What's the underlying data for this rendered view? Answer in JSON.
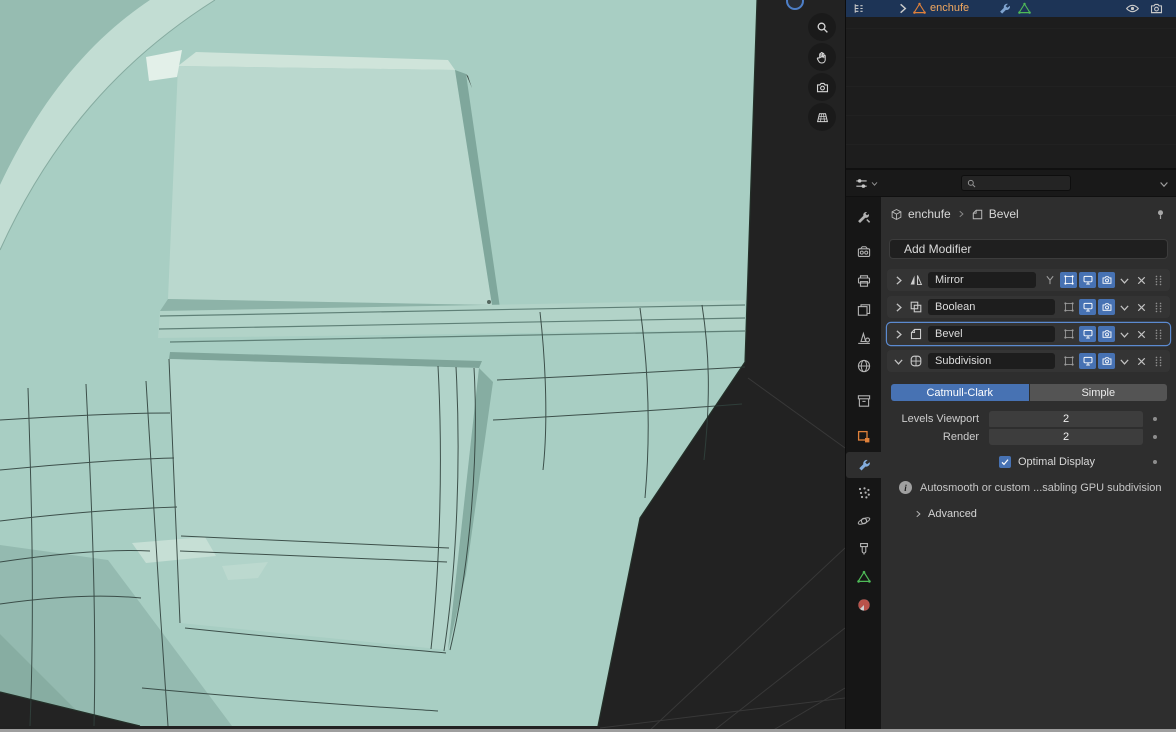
{
  "colors": {
    "accent": "#4772b3",
    "mesh": "#a8cec3",
    "selected_row": "#1d3456",
    "object_icon": "#e0813a",
    "mesh_data_icon": "#4fba58"
  },
  "viewport": {
    "nav_icons": [
      "zoom",
      "pan",
      "camera-view",
      "perspective-grid"
    ],
    "gizmo": "axis-ball-partial"
  },
  "outliner": {
    "object": {
      "name": "enchufe"
    }
  },
  "properties": {
    "search_placeholder": "",
    "breadcrumb": {
      "object": "enchufe",
      "modifier": "Bevel"
    },
    "add_modifier_label": "Add Modifier",
    "modifiers": [
      {
        "name": "Mirror",
        "type": "Mirror",
        "active": false,
        "expanded": false
      },
      {
        "name": "Boolean",
        "type": "Boolean",
        "active": false,
        "expanded": false
      },
      {
        "name": "Bevel",
        "type": "Bevel",
        "active": true,
        "expanded": false
      },
      {
        "name": "Subdivision",
        "type": "Subdivision",
        "active": false,
        "expanded": true
      }
    ],
    "subdivision": {
      "options": [
        "Catmull-Clark",
        "Simple"
      ],
      "selected_option": "Catmull-Clark",
      "levels_viewport_label": "Levels Viewport",
      "levels_viewport_value": "2",
      "render_label": "Render",
      "render_value": "2",
      "optimal_display_label": "Optimal Display",
      "optimal_display_checked": true,
      "info_message": "Autosmooth or custom ...sabling GPU subdivision",
      "advanced_label": "Advanced"
    },
    "tabs": [
      "tool",
      "render",
      "output",
      "view-layer",
      "scene",
      "world",
      "collection",
      "object",
      "modifiers",
      "particles",
      "physics",
      "constraints",
      "object-data",
      "material"
    ],
    "active_tab": "modifiers"
  }
}
